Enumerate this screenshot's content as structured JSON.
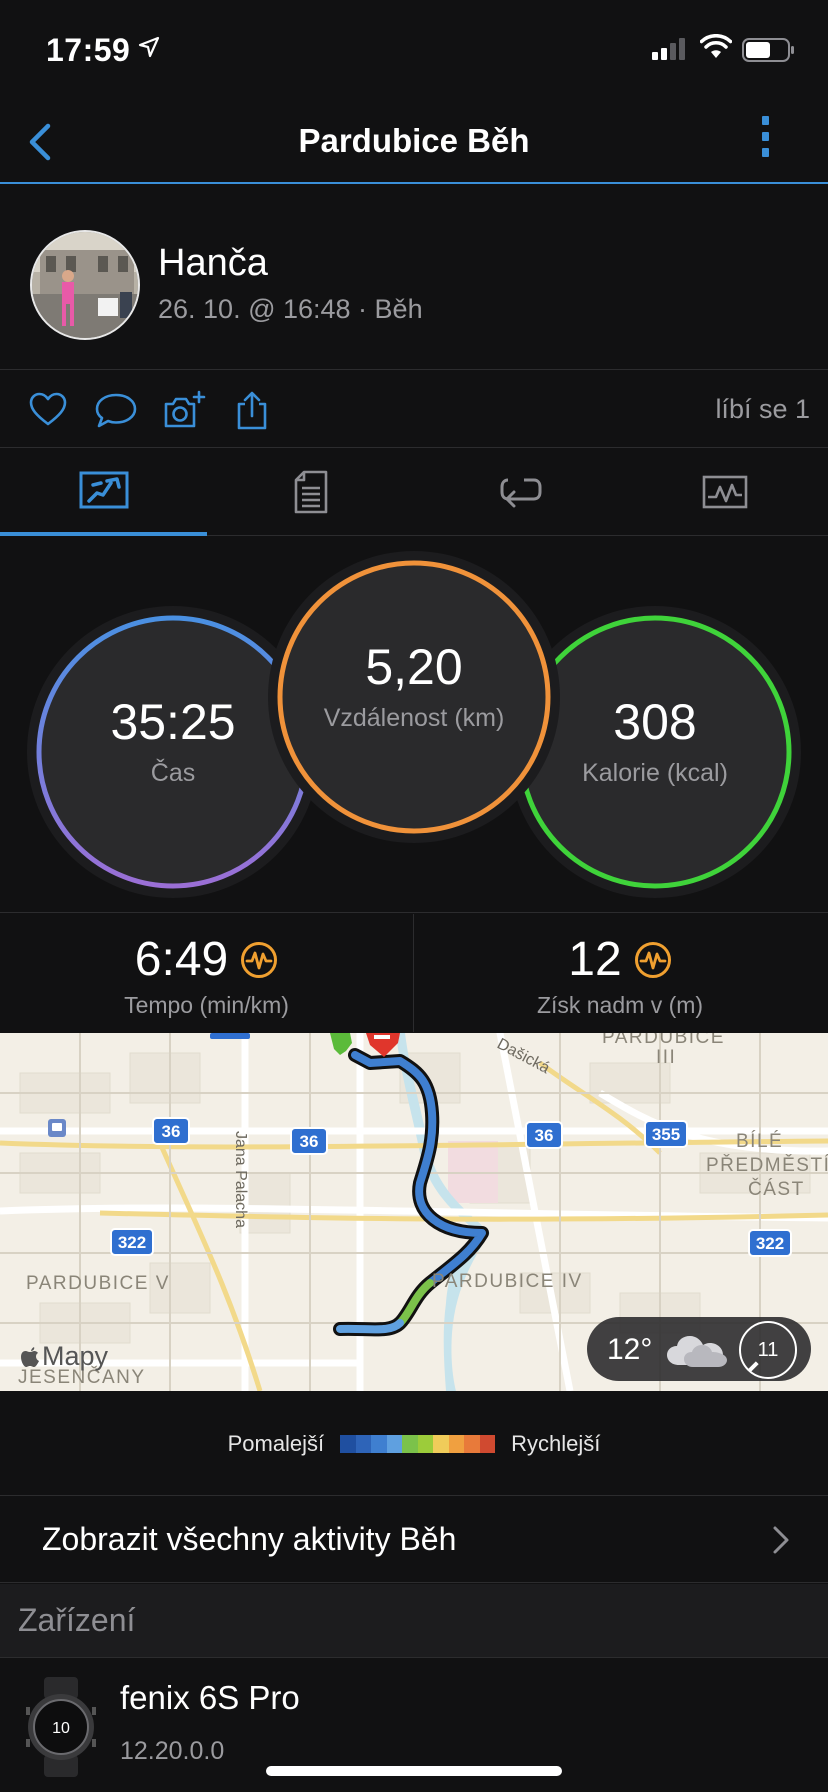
{
  "status": {
    "time": "17:59"
  },
  "nav": {
    "title": "Pardubice Běh"
  },
  "profile": {
    "name": "Hanča",
    "meta": "26. 10. @ 16:48 · Běh"
  },
  "actions": {
    "likes": "líbí se 1"
  },
  "stats": {
    "time": {
      "value": "35:25",
      "label": "Čas",
      "colors": [
        "#4a90e2",
        "#9b6fd6"
      ]
    },
    "distance": {
      "value": "5,20",
      "label": "Vzdálenost (km)",
      "color": "#f0923a"
    },
    "calories": {
      "value": "308",
      "label": "Kalorie (kcal)",
      "color": "#3fd33a"
    }
  },
  "pace": {
    "value": "6:49",
    "label": "Tempo (min/km)"
  },
  "elevation": {
    "value": "12",
    "label": "Získ nadm v (m)"
  },
  "map": {
    "labels": {
      "pardubice_iii": "PARDUBICE",
      "pardubice_iii_num": "III",
      "dasicka": "Dašická",
      "bile": "BÍLÉ",
      "predmesti": "PŘEDMĚSTÍ",
      "cast": "ČÁST",
      "jana_palacha": "Jana Palacha",
      "pardubice_v": "PARDUBICE V",
      "pardubice_iv": "PARDUBICE IV",
      "jesencany": "JESENČANY"
    },
    "road_shields": [
      "36",
      "36",
      "36",
      "355",
      "322",
      "322"
    ],
    "attribution": "Mapy",
    "weather": {
      "temp": "12°",
      "aqi": "11"
    }
  },
  "legend": {
    "slow": "Pomalejší",
    "fast": "Rychlejší",
    "colors": [
      "#1f4fa0",
      "#2e64b8",
      "#3f7fd0",
      "#5fa0e0",
      "#7bc24a",
      "#9ccc3a",
      "#f0cc5a",
      "#f0a040",
      "#e87a3a",
      "#d04a30"
    ]
  },
  "viewall": {
    "label": "Zobrazit všechny aktivity Běh"
  },
  "devices": {
    "header": "Zařízení",
    "name": "fenix 6S Pro",
    "version": "12.20.0.0",
    "watch_face": "10"
  }
}
